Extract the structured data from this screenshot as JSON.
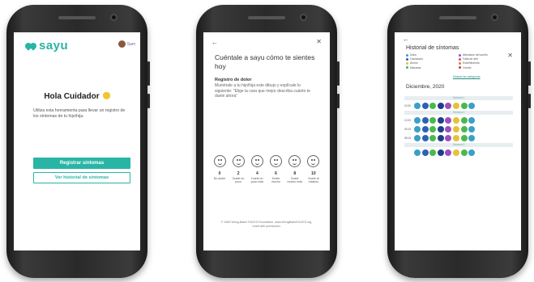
{
  "colors": {
    "brand": "#28b5a6",
    "text": "#333333",
    "screen": "#ffffff",
    "phone": "#2a2a2a"
  },
  "screen1": {
    "logo_text": "sayu",
    "user_name": "Sam",
    "greeting": "Hola Cuidador",
    "greeting_emoji_icon": "waving-hand-icon",
    "intro": "Utiliza esta herramienta para llevar un registro de los síntomas de tu hijo/hija.",
    "primary_button": "Registrar síntomas",
    "secondary_button": "Ver historial de síntomas"
  },
  "screen2": {
    "back_icon": "arrow-left-icon",
    "close_icon": "close-icon",
    "title": "Cuéntale a sayu cómo te sientes hoy",
    "section_title": "Registro de dolor",
    "section_body": "Muéstrale a tu hijo/hija este dibujo y explícale lo siguiente: \"Elige la cara que mejor describa cuánto te duele ahora\"",
    "faces": [
      {
        "value": "0",
        "label": "No duele"
      },
      {
        "value": "2",
        "label": "Duele un poco"
      },
      {
        "value": "4",
        "label": "Duele un poco más"
      },
      {
        "value": "6",
        "label": "Duele mucho"
      },
      {
        "value": "8",
        "label": "Duele mucho más"
      },
      {
        "value": "10",
        "label": "Duele al máximo"
      }
    ],
    "footer": "© 1983 Wong-Baker FACES Foundation. www.WongBakerFACES.org. Used with permission."
  },
  "screen3": {
    "back_icon": "arrow-left-icon",
    "close_icon": "close-icon",
    "title": "Historial de síntomas",
    "legend": [
      {
        "label": "Dolor",
        "color": "#3aa0c8"
      },
      {
        "label": "Alteración del sueño",
        "color": "#9b4fc0"
      },
      {
        "label": "Cansancio",
        "color": "#2e5fb8"
      },
      {
        "label": "Falta de aire",
        "color": "#d04a8a"
      },
      {
        "label": "Ánimo",
        "color": "#e4c23a"
      },
      {
        "label": "Estreñimiento",
        "color": "#e07a2e"
      },
      {
        "label": "Náuseas",
        "color": "#4cb84c"
      },
      {
        "label": "Vómito",
        "color": "#d03838"
      }
    ],
    "legend_link": "Mostrar las categorías",
    "month": "Diciembre, 2020",
    "weeks": [
      {
        "label": "Semana 1",
        "rows": [
          {
            "time": "10:30",
            "dots": [
              "#3aa0c8",
              "#2e5fb8",
              "#4cb84c",
              "#1e3e8c",
              "#9b4fc0",
              "#e4c23a",
              "#4cb84c",
              "#3aa0c8"
            ]
          }
        ]
      },
      {
        "label": "Semana 2",
        "rows": [
          {
            "time": "12:20",
            "dots": [
              "#3aa0c8",
              "#2e5fb8",
              "#4cb84c",
              "#1e3e8c",
              "#9b4fc0",
              "#e4c23a",
              "#4cb84c",
              "#3aa0c8"
            ]
          },
          {
            "time": "09:15",
            "dots": [
              "#3aa0c8",
              "#2e5fb8",
              "#4cb84c",
              "#1e3e8c",
              "#9b4fc0",
              "#e4c23a",
              "#4cb84c",
              "#3aa0c8"
            ]
          },
          {
            "time": "08:15",
            "dots": [
              "#3aa0c8",
              "#2e5fb8",
              "#4cb84c",
              "#1e3e8c",
              "#9b4fc0",
              "#e4c23a",
              "#4cb84c",
              "#3aa0c8"
            ]
          }
        ]
      },
      {
        "label": "Semana 3",
        "rows": [
          {
            "time": "",
            "dots": [
              "#3aa0c8",
              "#2e5fb8",
              "#4cb84c",
              "#1e3e8c",
              "#9b4fc0",
              "#e4c23a",
              "#4cb84c",
              "#3aa0c8"
            ]
          }
        ]
      }
    ]
  }
}
